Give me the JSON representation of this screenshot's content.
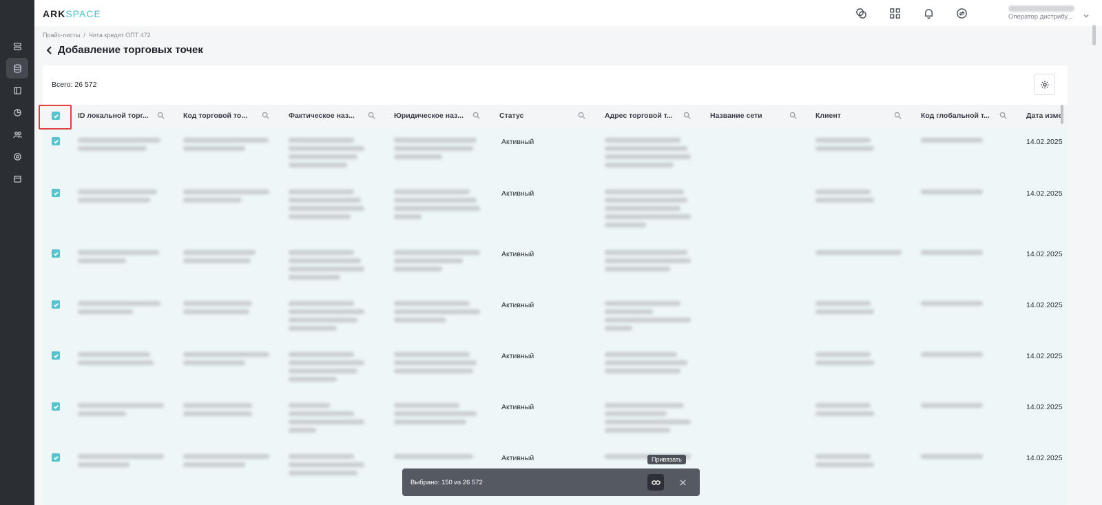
{
  "app": {
    "logo_main": "ARK",
    "logo_accent": "SPACE"
  },
  "header": {
    "user_role": "Оператор дистрибу..."
  },
  "breadcrumb": [
    "Прайс-листы",
    "Чита кредит ОПТ 472"
  ],
  "breadcrumb_sep": "/",
  "page_title": "Добавление торговых точек",
  "total_label": "Всего: 26 572",
  "columns": [
    "ID локальной торг...",
    "Код торговой то...",
    "Фактическое наз...",
    "Юридическое наз...",
    "Статус",
    "Адрес торговой т...",
    "Название сети",
    "Клиент",
    "Код глобальной т...",
    "Дата изме"
  ],
  "rows": [
    {
      "status": "Активный",
      "date": "14.02.2025"
    },
    {
      "status": "Активный",
      "date": "14.02.2025"
    },
    {
      "status": "Активный",
      "date": "14.02.2025"
    },
    {
      "status": "Активный",
      "date": "14.02.2025"
    },
    {
      "status": "Активный",
      "date": "14.02.2025"
    },
    {
      "status": "Активный",
      "date": "14.02.2025"
    },
    {
      "status": "Активный",
      "date": "14.02.2025"
    }
  ],
  "selection_bar": {
    "text": "Выбрано: 150 из 26 572",
    "tooltip": "Привязать"
  },
  "colors": {
    "accent": "#58c3cc",
    "row_bg": "#eef7f7",
    "sidebar": "#2b2e33",
    "highlight": "#e0403a"
  }
}
